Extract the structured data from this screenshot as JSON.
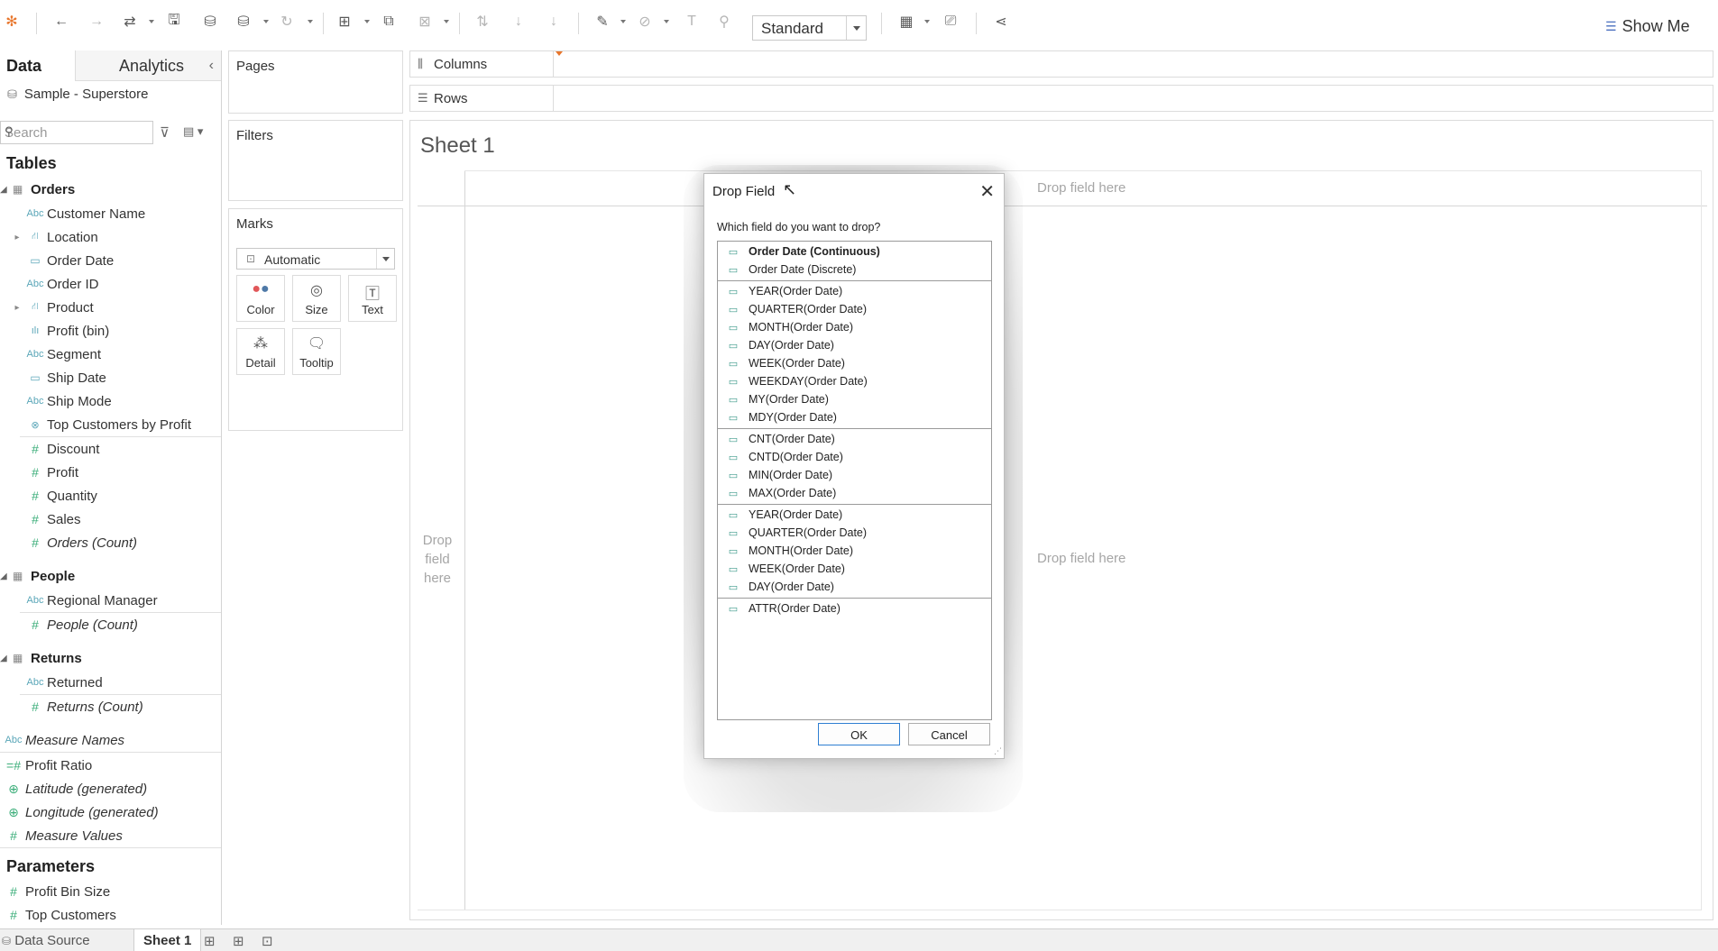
{
  "toolbar": {
    "view_select": "Standard",
    "show_me": "Show Me"
  },
  "data_pane": {
    "tab_data": "Data",
    "tab_analytics": "Analytics",
    "datasource": "Sample - Superstore",
    "search_placeholder": "Search",
    "tables_heading": "Tables",
    "orders": {
      "name": "Orders",
      "fields": [
        {
          "label": "Customer Name",
          "type": "abc"
        },
        {
          "label": "Location",
          "type": "geo",
          "expandable": true
        },
        {
          "label": "Order Date",
          "type": "date"
        },
        {
          "label": "Order ID",
          "type": "abc"
        },
        {
          "label": "Product",
          "type": "geo",
          "expandable": true
        },
        {
          "label": "Profit (bin)",
          "type": "bin"
        },
        {
          "label": "Segment",
          "type": "abc"
        },
        {
          "label": "Ship Date",
          "type": "date"
        },
        {
          "label": "Ship Mode",
          "type": "abc"
        },
        {
          "label": "Top Customers by Profit",
          "type": "set"
        }
      ],
      "measures": [
        {
          "label": "Discount"
        },
        {
          "label": "Profit"
        },
        {
          "label": "Quantity"
        },
        {
          "label": "Sales"
        },
        {
          "label": "Orders (Count)",
          "italic": true
        }
      ]
    },
    "people": {
      "name": "People",
      "fields": [
        {
          "label": "Regional Manager"
        }
      ],
      "measures": [
        {
          "label": "People (Count)",
          "italic": true
        }
      ]
    },
    "returns": {
      "name": "Returns",
      "fields": [
        {
          "label": "Returned"
        }
      ],
      "measures": [
        {
          "label": "Returns (Count)",
          "italic": true
        }
      ]
    },
    "extra": [
      {
        "label": "Measure Names",
        "italic": true
      },
      {
        "label": "Profit Ratio",
        "italic": false
      },
      {
        "label": "Latitude (generated)",
        "italic": true
      },
      {
        "label": "Longitude (generated)",
        "italic": true
      },
      {
        "label": "Measure Values",
        "italic": true
      }
    ],
    "parameters_heading": "Parameters",
    "parameters": [
      {
        "label": "Profit Bin Size"
      },
      {
        "label": "Top Customers"
      }
    ]
  },
  "cards": {
    "pages": "Pages",
    "filters": "Filters",
    "marks": "Marks",
    "marks_type": "Automatic",
    "mark_buttons": [
      "Color",
      "Size",
      "Text",
      "Detail",
      "Tooltip"
    ]
  },
  "shelves": {
    "columns": "Columns",
    "rows": "Rows"
  },
  "sheet": {
    "title": "Sheet 1",
    "drop_hint": "Drop field here",
    "drop_hint_left_lines": [
      "Drop",
      "field",
      "here"
    ]
  },
  "bottom": {
    "data_source": "Data Source",
    "sheet_tab": "Sheet 1"
  },
  "dialog": {
    "title": "Drop Field",
    "question": "Which field do you want to drop?",
    "groups": [
      [
        "Order Date (Continuous)",
        "Order Date (Discrete)"
      ],
      [
        "YEAR(Order Date)",
        "QUARTER(Order Date)",
        "MONTH(Order Date)",
        "DAY(Order Date)",
        "WEEK(Order Date)",
        "WEEKDAY(Order Date)",
        "MY(Order Date)",
        "MDY(Order Date)"
      ],
      [
        "CNT(Order Date)",
        "CNTD(Order Date)",
        "MIN(Order Date)",
        "MAX(Order Date)"
      ],
      [
        "YEAR(Order Date)",
        "QUARTER(Order Date)",
        "MONTH(Order Date)",
        "WEEK(Order Date)",
        "DAY(Order Date)"
      ],
      [
        "ATTR(Order Date)"
      ]
    ],
    "ok": "OK",
    "cancel": "Cancel"
  }
}
